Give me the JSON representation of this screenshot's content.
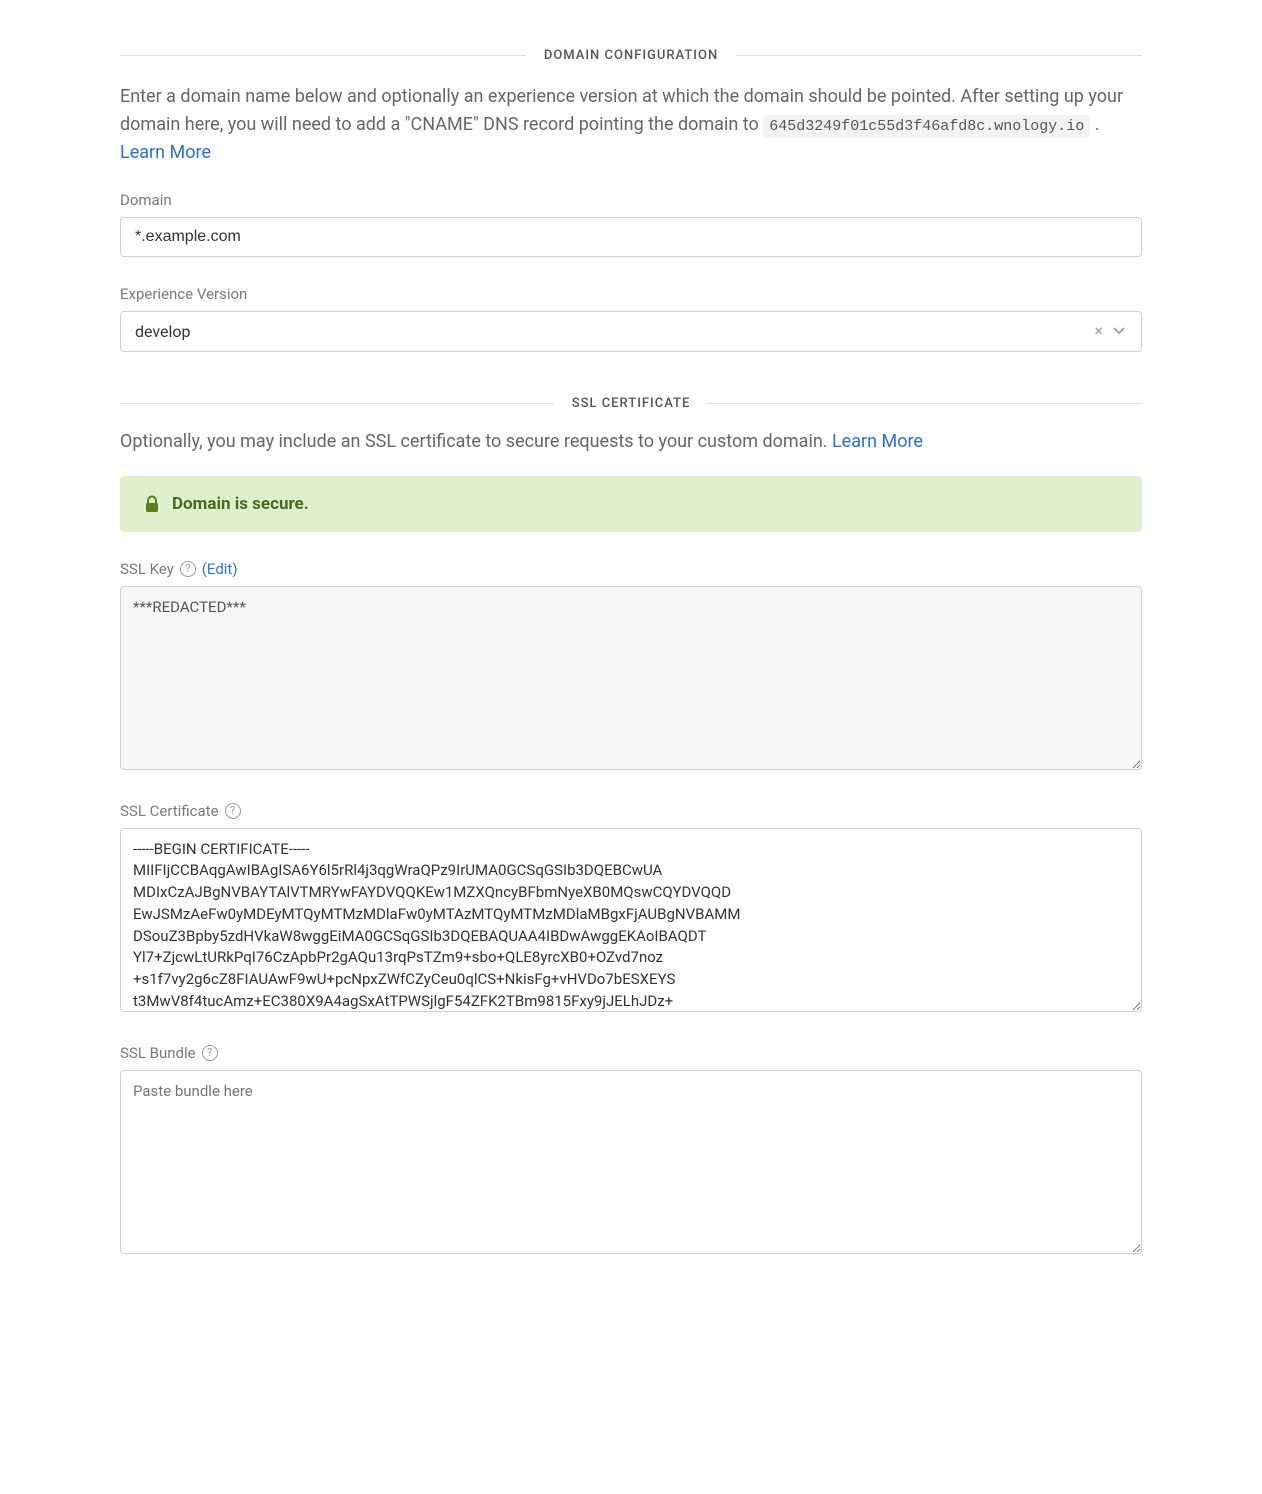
{
  "section1": {
    "title": "DOMAIN CONFIGURATION",
    "intro_pre": "Enter a domain name below and optionally an experience version at which the domain should be pointed. After setting up your domain here, you will need to add a \"CNAME\" DNS record pointing the domain to ",
    "intro_code": "645d3249f01c55d3f46afd8c.wnology.io",
    "intro_post": " . ",
    "learn_more": "Learn More"
  },
  "domain": {
    "label": "Domain",
    "value": "*.example.com"
  },
  "experience": {
    "label": "Experience Version",
    "value": "develop"
  },
  "section2": {
    "title": "SSL CERTIFICATE",
    "intro": "Optionally, you may include an SSL certificate to secure requests to your custom domain. ",
    "learn_more": "Learn More"
  },
  "secure_banner": "Domain is secure.",
  "ssl_key": {
    "label": "SSL Key",
    "edit": "(Edit)",
    "value": "***REDACTED***"
  },
  "ssl_cert": {
    "label": "SSL Certificate",
    "value": "-----BEGIN CERTIFICATE-----\nMIIFIjCCBAqgAwIBAgISA6Y6l5rRl4j3qgWraQPz9IrUMA0GCSqGSIb3DQEBCwUA\nMDIxCzAJBgNVBAYTAlVTMRYwFAYDVQQKEw1MZXQncyBFbmNyeXB0MQswCQYDVQQD\nEwJSMzAeFw0yMDEyMTQyMTMzMDlaFw0yMTAzMTQyMTMzMDlaMBgxFjAUBgNVBAMM\nDSouZ3Bpby5zdHVkaW8wggEiMA0GCSqGSIb3DQEBAQUAA4IBDwAwggEKAoIBAQDT\nYl7+ZjcwLtURkPqI76CzApbPr2gAQu13rqPsTZm9+sbo+QLE8yrcXB0+OZvd7noz\n+s1f7vy2g6cZ8FIAUAwF9wU+pcNpxZWfCZyCeu0qlCS+NkisFg+vHVDo7bESXEYS\nt3MwV8f4tucAmz+EC380X9A4agSxAtTPWSjlgF54ZFK2TBm9815Fxy9jJELhJDz+\n"
  },
  "ssl_bundle": {
    "label": "SSL Bundle",
    "placeholder": "Paste bundle here",
    "value": ""
  }
}
